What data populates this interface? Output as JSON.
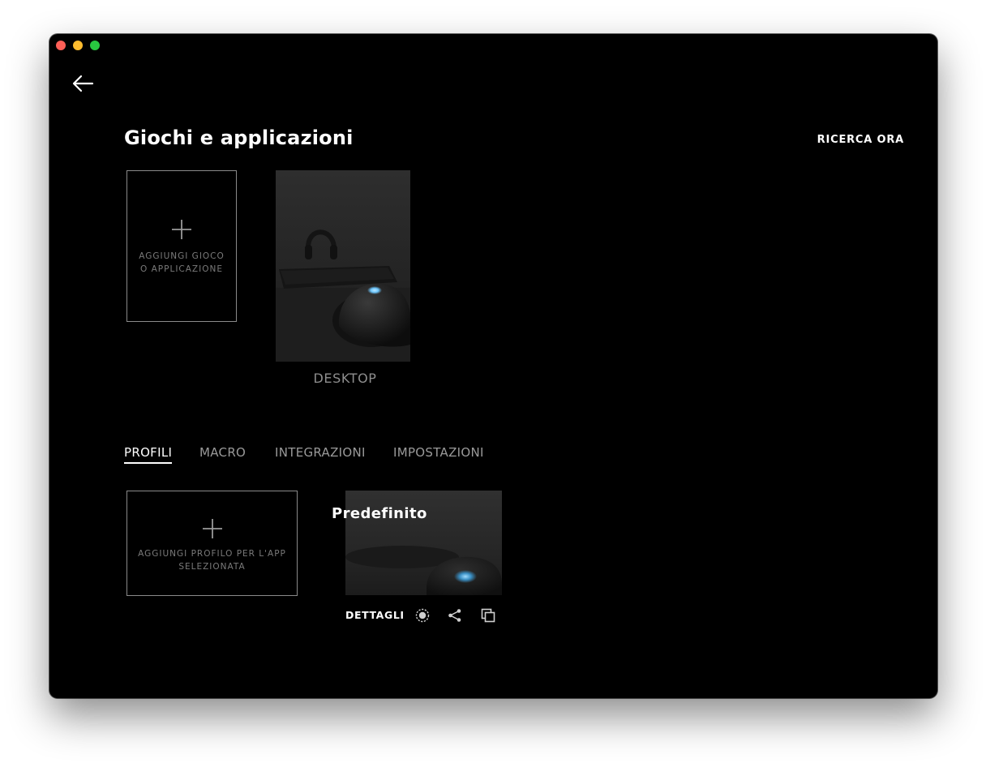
{
  "window": {
    "controls": [
      "close",
      "minimize",
      "maximize"
    ]
  },
  "header": {
    "back_icon": "arrow-left-icon",
    "title": "Giochi e applicazioni",
    "search_now": "RICERCA ORA"
  },
  "apps": {
    "add_label_line1": "AGGIUNGI GIOCO",
    "add_label_line2": "O APPLICAZIONE",
    "items": [
      {
        "label": "DESKTOP"
      }
    ]
  },
  "tabs": [
    {
      "label": "PROFILI",
      "active": true
    },
    {
      "label": "MACRO",
      "active": false
    },
    {
      "label": "INTEGRAZIONI",
      "active": false
    },
    {
      "label": "IMPOSTAZIONI",
      "active": false
    }
  ],
  "profiles": {
    "add_label_line1": "AGGIUNGI PROFILO PER L'APP",
    "add_label_line2": "SELEZIONATA",
    "items": [
      {
        "name": "Predefinito",
        "details_label": "DETTAGLI",
        "actions": [
          "persistent-profile-icon",
          "share-icon",
          "duplicate-icon"
        ]
      }
    ]
  },
  "colors": {
    "background": "#000000",
    "text_primary": "#ffffff",
    "text_muted": "#9a9a9a",
    "border": "#8a8a8a",
    "accent_glow": "#6ec8ff"
  }
}
